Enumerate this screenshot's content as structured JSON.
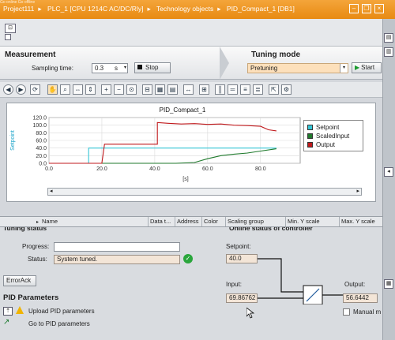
{
  "title_bar": {
    "top_strip": "Go online   Go offline",
    "crumbs": [
      "Project111",
      "PLC_1 [CPU 1214C AC/DC/Rly]",
      "Technology objects",
      "PID_Compact_1 [DB1]"
    ]
  },
  "measurement": {
    "title": "Measurement",
    "sampling_label": "Sampling time:",
    "sampling_value": "0.3",
    "sampling_unit": "s",
    "stop_label": "Stop"
  },
  "tuning": {
    "title": "Tuning mode",
    "mode_value": "Pretuning",
    "start_label": "Start"
  },
  "chart_data": {
    "type": "line",
    "title": "PID_Compact_1",
    "ylabel": "Setpoint",
    "xlabel": "[s]",
    "xlim": [
      0,
      95
    ],
    "ylim": [
      0,
      120
    ],
    "x_ticks": [
      0.0,
      20.0,
      40.0,
      60.0,
      80.0
    ],
    "y_ticks": [
      0.0,
      20.0,
      40.0,
      60.0,
      80.0,
      100.0,
      120.0
    ],
    "legend_position": "right",
    "series": [
      {
        "name": "Setpoint",
        "color": "#35c6d6",
        "x": [
          0,
          15,
          15,
          86
        ],
        "y": [
          0,
          0,
          40,
          40
        ]
      },
      {
        "name": "ScaledInput",
        "color": "#1f7a2c",
        "x": [
          0,
          20,
          48,
          55,
          60,
          65,
          70,
          75,
          80,
          86
        ],
        "y": [
          0,
          0,
          0,
          2,
          12,
          20,
          24,
          27,
          32,
          38
        ]
      },
      {
        "name": "Output",
        "color": "#c0191c",
        "x": [
          0,
          20,
          21,
          41,
          41,
          45,
          50,
          55,
          60,
          65,
          70,
          75,
          80,
          83,
          86
        ],
        "y": [
          0,
          0,
          50,
          50,
          107,
          105,
          103,
          104,
          102,
          103,
          100,
          99,
          97,
          88,
          85
        ]
      }
    ]
  },
  "table": {
    "columns": [
      "Name",
      "Data t...",
      "Address",
      "Color",
      "Scaling group",
      "Min. Y scale",
      "Max. Y scale"
    ]
  },
  "bottom": {
    "tuning_status": "Tuning status",
    "online_status": "Online status of controller",
    "progress_label": "Progress:",
    "status_label": "Status:",
    "status_value": "System tuned.",
    "error_ack": "ErrorAck",
    "pid_params_title": "PID Parameters",
    "upload_label": "Upload PID parameters",
    "goto_label": "Go to PID parameters",
    "setpoint_label": "Setpoint:",
    "setpoint_value": "40.0",
    "input_label": "Input:",
    "input_value": "69.86762",
    "output_label": "Output:",
    "output_value": "56.6442",
    "manual_label": "Manual m"
  }
}
